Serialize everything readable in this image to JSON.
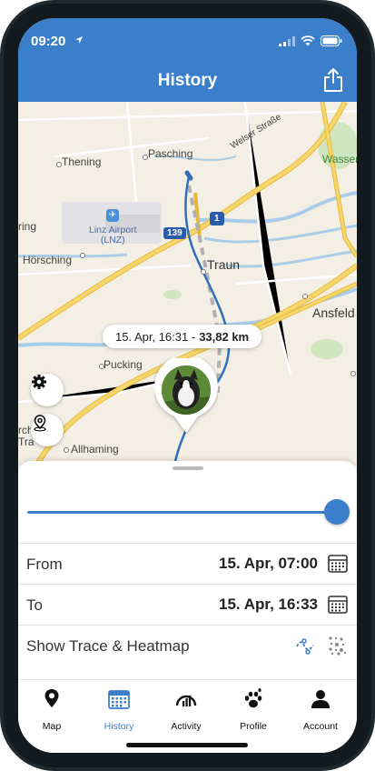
{
  "status": {
    "time": "09:20"
  },
  "header": {
    "title": "History",
    "share_icon": "share-icon"
  },
  "map": {
    "places": {
      "thening": "Thening",
      "pasching": "Pasching",
      "welser": "Welser Straße",
      "wasserwerk": "Wasserw",
      "ring": "ring",
      "airport": "Linz Airport\n(LNZ)",
      "hoersching": "Hörsching",
      "traun": "Traun",
      "ansfelden": "Ansfeld",
      "pucking": "Pucking",
      "kirchen": "rchen",
      "tra": "Tra",
      "allhaming": "Allhaming",
      "road_139": "139",
      "road_1": "1"
    },
    "time_pill": {
      "time": "15. Apr, 16:31 -",
      "distance": "33,82 km"
    }
  },
  "sheet": {
    "slider_position": 1.0,
    "from": {
      "label": "From",
      "value": "15. Apr, 07:00"
    },
    "to": {
      "label": "To",
      "value": "15. Apr, 16:33"
    },
    "trace": {
      "label": "Show Trace & Heatmap"
    }
  },
  "tabs": [
    {
      "label": "Map",
      "icon": "map-pin-icon",
      "active": false
    },
    {
      "label": "History",
      "icon": "calendar-icon",
      "active": true
    },
    {
      "label": "Activity",
      "icon": "activity-gauge-icon",
      "active": false
    },
    {
      "label": "Profile",
      "icon": "paw-icon",
      "active": false
    },
    {
      "label": "Account",
      "icon": "person-icon",
      "active": false
    }
  ],
  "colors": {
    "accent": "#3b7fcb",
    "map_bg": "#f3efe4",
    "road_yellow": "#f2c94c",
    "water": "#a9cde8"
  }
}
